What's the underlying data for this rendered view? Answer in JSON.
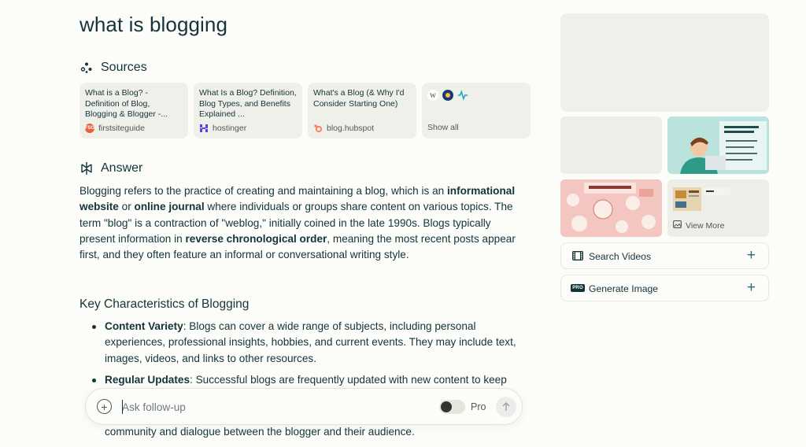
{
  "query": "what is blogging",
  "sources_heading": "Sources",
  "answer_heading": "Answer",
  "sources": [
    {
      "title": "What is a Blog? - Definition of Blog, Blogging & Blogger -...",
      "site": "firstsiteguide"
    },
    {
      "title": "What Is a Blog? Definition, Blog Types, and Benefits Explained ...",
      "site": "hostinger"
    },
    {
      "title": "What's a Blog (& Why I'd Consider Starting One)",
      "site": "blog.hubspot"
    }
  ],
  "show_all_label": "Show all",
  "answer": {
    "p1_a": "Blogging refers to the practice of creating and maintaining a blog, which is an ",
    "p1_b1": "informational website",
    "p1_c": " or ",
    "p1_b2": "online journal",
    "p1_d": " where individuals or groups share content on various topics. The term \"blog\" is a contraction of \"weblog,\" initially coined in the late 1990s. Blogs typically present information in ",
    "p1_b3": "reverse chronological order",
    "p1_e": ", meaning the most recent posts appear first, and they often feature an informal or conversational writing style."
  },
  "section_heading": "Key Characteristics of Blogging",
  "bullets": [
    {
      "term": "Content Variety",
      "text": ": Blogs can cover a wide range of subjects, including personal experiences, professional insights, hobbies, and current events. They may include text, images, videos, and links to other resources."
    },
    {
      "term": "Regular Updates",
      "text": ": Successful blogs are frequently updated with new content to keep"
    }
  ],
  "tail_text": "community and dialogue between the blogger and their audience.",
  "followup": {
    "placeholder": "Ask follow-up",
    "pro_label": "Pro"
  },
  "sidebar": {
    "view_more_label": "View More",
    "search_videos_label": "Search Videos",
    "generate_image_label": "Generate Image"
  },
  "colors": {
    "background": "#fcfcf9",
    "card": "#f0f0ea",
    "text": "#13343b",
    "accent": "#2a6f78"
  }
}
